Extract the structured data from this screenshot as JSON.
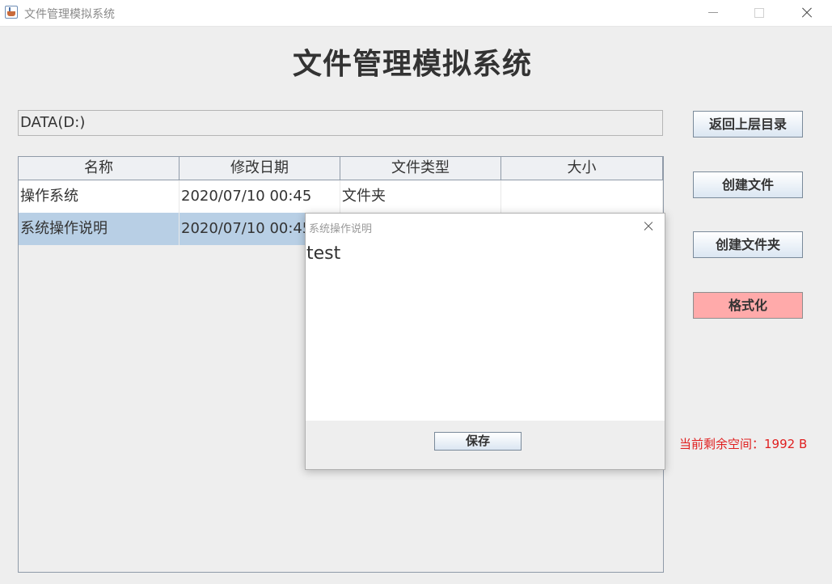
{
  "window": {
    "title": "文件管理模拟系统"
  },
  "header": {
    "title": "文件管理模拟系统"
  },
  "path": {
    "value": "DATA(D:)"
  },
  "table": {
    "columns": [
      "名称",
      "修改日期",
      "文件类型",
      "大小"
    ],
    "rows": [
      {
        "name": "操作系统",
        "date": "2020/07/10 00:45",
        "type": "文件夹",
        "size": "",
        "selected": false
      },
      {
        "name": "系统操作说明",
        "date": "2020/07/10 00:45",
        "type": "",
        "size": "",
        "selected": true
      }
    ]
  },
  "sidebar": {
    "back_label": "返回上层目录",
    "create_file_label": "创建文件",
    "create_folder_label": "创建文件夹",
    "format_label": "格式化",
    "space_label": "当前剩余空间：1992 B"
  },
  "dialog": {
    "title": "系统操作说明",
    "content": "test",
    "save_label": "保存"
  },
  "colors": {
    "selected_row": "#b8cfe5",
    "format_button": "#ffaaaa",
    "space_text": "#e02020"
  }
}
